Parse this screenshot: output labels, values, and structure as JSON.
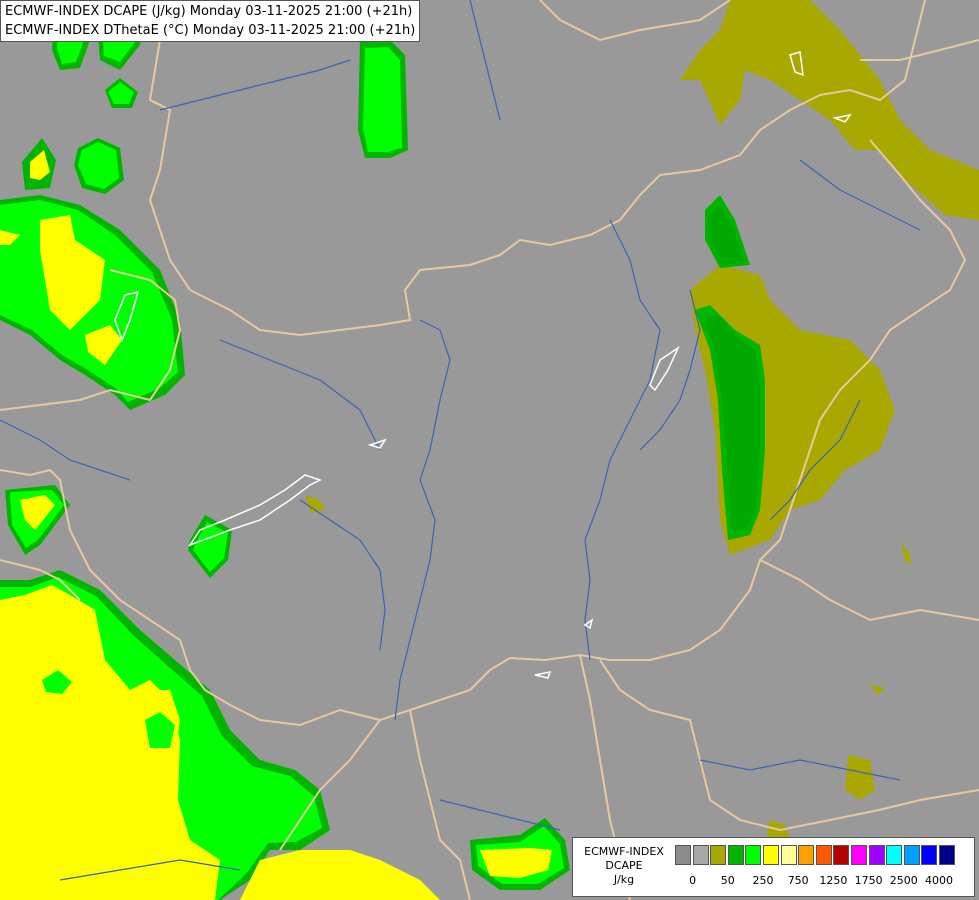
{
  "title": {
    "line1": "ECMWF-INDEX DCAPE (J/kg) Monday 03-11-2025 21:00 (+21h)",
    "line2": "ECMWF-INDEX DThetaE (°C) Monday 03-11-2025 21:00 (+21h)"
  },
  "legend": {
    "label_line1": "ECMWF-INDEX",
    "label_line2": "DCAPE",
    "label_line3": "J/kg",
    "colors": [
      "#8c8c8c",
      "#a8a8a8",
      "#a8a800",
      "#00b400",
      "#00ff00",
      "#ffff00",
      "#ffff96",
      "#ffa000",
      "#ff5a00",
      "#b40000",
      "#ff00ff",
      "#a000ff",
      "#00ffff",
      "#00a0ff",
      "#0000ff",
      "#00008c"
    ],
    "ticks": [
      "0",
      "50",
      "250",
      "750",
      "1250",
      "1750",
      "2500",
      "4000"
    ]
  },
  "colors": {
    "background": "#999999",
    "border": "#e8c8a0",
    "river": "#3c64b4",
    "lake": "#ffffff"
  }
}
